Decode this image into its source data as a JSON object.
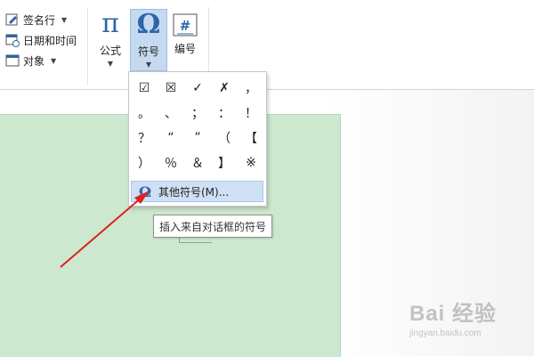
{
  "ribbon": {
    "small_buttons": [
      {
        "label": "签名行",
        "icon": "signature-line-icon",
        "has_arrow": true
      },
      {
        "label": "日期和时间",
        "icon": "date-time-icon",
        "has_arrow": false
      },
      {
        "label": "对象",
        "icon": "object-icon",
        "has_arrow": true
      }
    ],
    "formula": {
      "glyph": "π",
      "label": "公式",
      "icon": "pi-icon"
    },
    "symbol": {
      "glyph": "Ω",
      "label": "符号",
      "icon": "omega-icon"
    },
    "number": {
      "glyph": "#",
      "label": "编号",
      "icon": "number-icon"
    },
    "accent_color": "#2e64a8"
  },
  "symbol_menu": {
    "symbols": [
      "☑",
      "☒",
      "✓",
      "✗",
      "，",
      "。",
      "、",
      "；",
      "：",
      "！",
      "？",
      "“",
      "”",
      "（",
      "【",
      "）",
      "％",
      "＆",
      "】",
      "※"
    ],
    "more_label": "其他符号(M)...",
    "more_icon": "omega-icon"
  },
  "tooltip": {
    "text": "插入来自对话框的符号"
  },
  "watermark": {
    "brand": "Bai 经验",
    "url": "jingyan.baidu.com"
  },
  "colors": {
    "page": "#cce8cf",
    "highlight": "#cfe0f5",
    "arrow": "#e02020"
  }
}
